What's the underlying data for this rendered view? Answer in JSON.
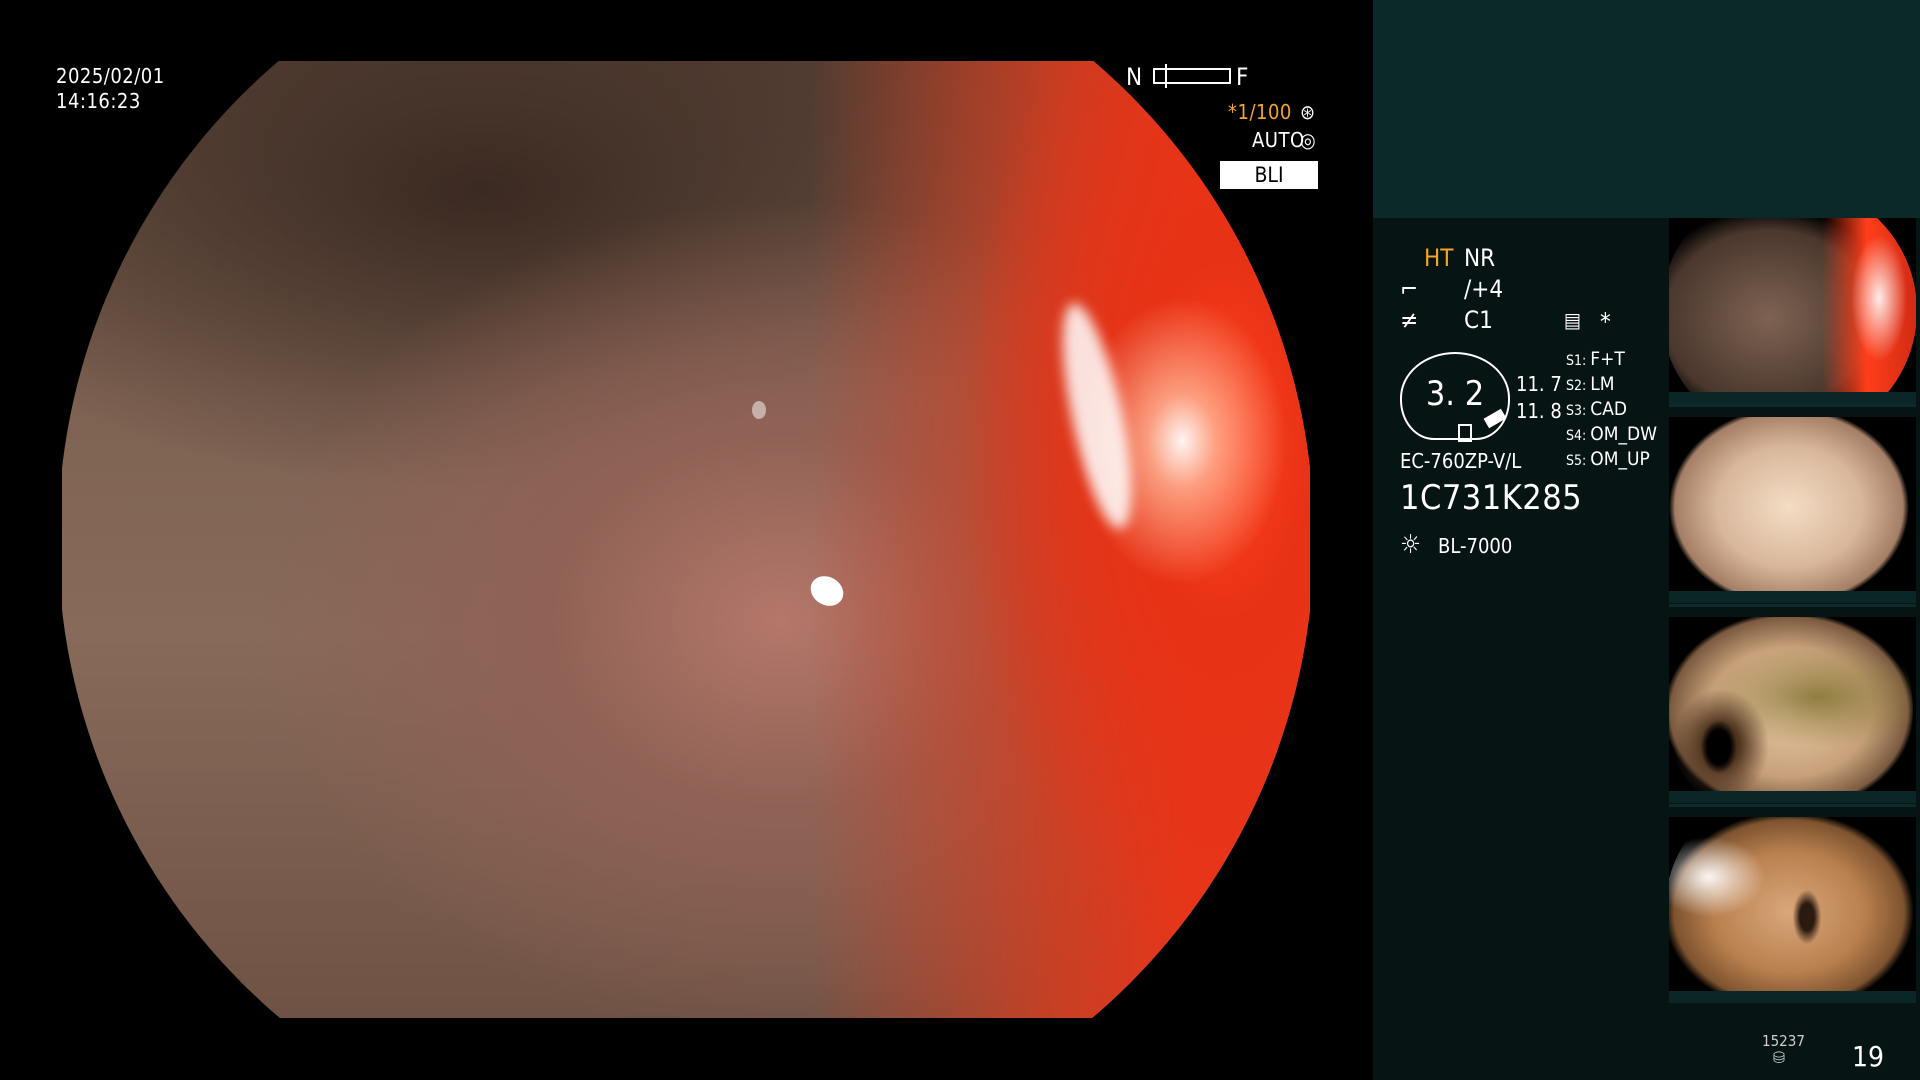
{
  "osd": {
    "date": "2025/02/01",
    "time": "14:16:23",
    "scale_near": "N",
    "scale_far": "F",
    "shutter": "*1/100",
    "shutter_icon": "aperture-icon",
    "iris": "AUTO",
    "iris_icon": "iris-icon",
    "mode_badge": "BLI"
  },
  "panel": {
    "ht": "HT",
    "nr": "NR",
    "enhance_value": "/+4",
    "color_value": "C1",
    "gauge_value": "3. 2",
    "side_values": [
      "11. 7",
      "11. 8"
    ],
    "asterisk": "*",
    "presets": [
      {
        "key": "S1:",
        "value": "F+T"
      },
      {
        "key": "S2:",
        "value": "LM"
      },
      {
        "key": "S3:",
        "value": "CAD"
      },
      {
        "key": "S4:",
        "value": "OM_DW"
      },
      {
        "key": "S5:",
        "value": "OM_UP"
      }
    ],
    "scope_model": "EC-760ZP-V/L",
    "serial": "1C731K285",
    "light_source": "BL-7000",
    "light_icon": "light-source-icon",
    "storage_count": "15237",
    "frame_number": "19"
  },
  "colors": {
    "panel_top": "#0c2929",
    "panel_main": "#071414",
    "accent_orange": "#f4a52a"
  }
}
